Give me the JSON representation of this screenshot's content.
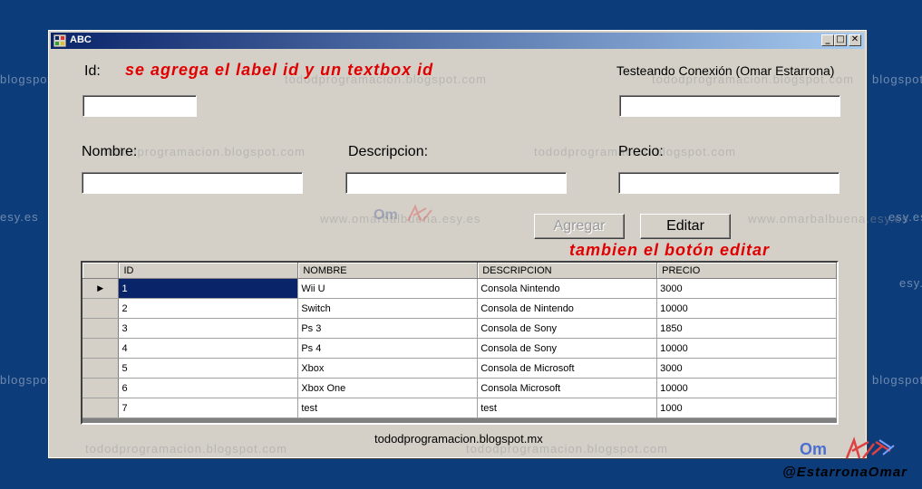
{
  "window": {
    "title": "ABC"
  },
  "title_controls": {
    "minimize": "_",
    "maximize": "□",
    "close": "✕"
  },
  "form": {
    "id_label": "Id:",
    "annotation_id": "se agrega el label id y un textbox id",
    "connection_label": "Testeando Conexión (Omar Estarrona)",
    "nombre_label": "Nombre:",
    "descripcion_label": "Descripcion:",
    "precio_label": "Precio:",
    "id_value": "",
    "connection_value": "",
    "nombre_value": "",
    "descripcion_value": "",
    "precio_value": "",
    "agregar_label": "Agregar",
    "editar_label": "Editar",
    "annotation_editar": "tambien el botón editar"
  },
  "grid": {
    "columns": [
      "ID",
      "NOMBRE",
      "DESCRIPCION",
      "PRECIO"
    ],
    "rows": [
      [
        "1",
        "Wii U",
        "Consola Nintendo",
        "3000"
      ],
      [
        "2",
        "Switch",
        "Consola de Nintendo",
        "10000"
      ],
      [
        "3",
        "Ps 3",
        "Consola de Sony",
        "1850"
      ],
      [
        "4",
        "Ps 4",
        "Consola de Sony",
        "10000"
      ],
      [
        "5",
        "Xbox",
        "Consola de Microsoft",
        "3000"
      ],
      [
        "6",
        "Xbox One",
        "Consola Microsoft",
        "10000"
      ],
      [
        "7",
        "test",
        "test",
        "1000"
      ]
    ],
    "current_row_marker": "▶"
  },
  "footer_text": "tododprogramacion.blogspot.mx",
  "watermarks": {
    "blog": "tododprogramacion.blogspot.com",
    "site": "www.omarbalbuena.esy.es",
    "blog_frag": "blogspot.com",
    "site_frag": "esy.es"
  },
  "branding": {
    "handle": "@EstarronaOmar",
    "logo_text": "Om"
  },
  "colors": {
    "background": "#0d3c7a",
    "annotation": "#e00000",
    "titlebar": "#0a246a",
    "selection": "#0a246a"
  }
}
